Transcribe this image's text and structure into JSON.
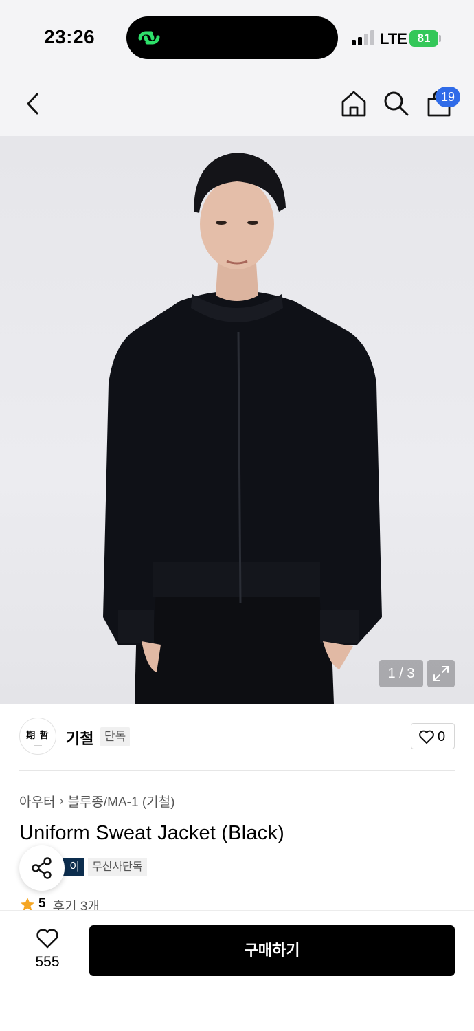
{
  "status_bar": {
    "time": "23:26",
    "network": "LTE",
    "battery": "81"
  },
  "header": {
    "cart_count": "19"
  },
  "image": {
    "counter": "1 / 3"
  },
  "brand": {
    "name": "기철",
    "tag": "단독",
    "logo_text": "期 哲",
    "like_count": "0"
  },
  "product": {
    "breadcrumb": [
      "아우터",
      "블루종/MA-1 (기철)"
    ],
    "title": "Uniform Sweat Jacket (Black)",
    "tags": [
      "이",
      "무신사단독"
    ],
    "rating": "5",
    "reviews": "후기 3개"
  },
  "bottom": {
    "wish_count": "555",
    "buy_label": "구매하기"
  },
  "colors": {
    "accent_blue": "#2f6be8",
    "tag_navy": "#0c2d4e",
    "battery_green": "#34c759"
  }
}
